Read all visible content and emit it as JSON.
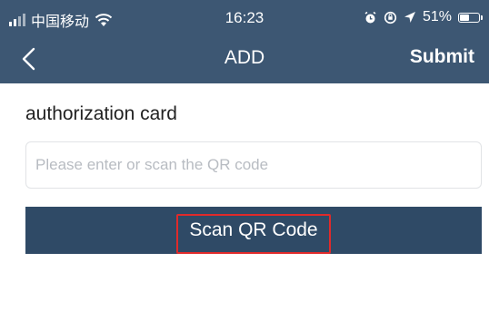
{
  "status_bar": {
    "carrier": "中国移动",
    "time": "16:23",
    "battery": "51%",
    "battery_level": 0.51
  },
  "nav": {
    "title": "ADD",
    "submit_label": "Submit"
  },
  "form": {
    "label": "authorization card",
    "input_value": "",
    "input_placeholder": "Please enter or scan the QR code",
    "scan_button_label": "Scan QR Code"
  },
  "colors": {
    "header_bg": "#3d5773",
    "button_bg": "#2f4a66",
    "highlight": "#e02a2a"
  }
}
